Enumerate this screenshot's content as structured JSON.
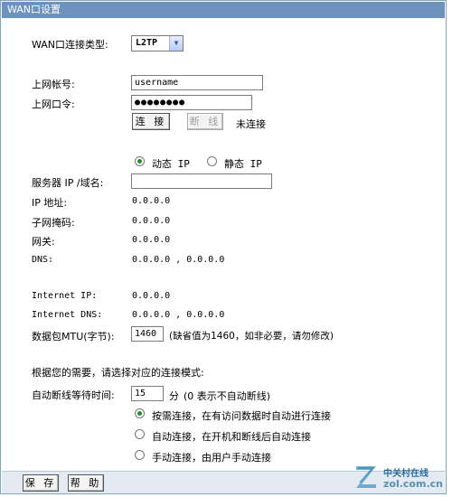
{
  "title": "WAN口设置",
  "wan_type": {
    "label": "WAN口连接类型:",
    "value": "L2TP"
  },
  "account": {
    "label": "上网帐号:",
    "value": "username"
  },
  "password": {
    "label": "上网口令:",
    "value": "●●●●●●●●"
  },
  "connect_button": "连 接",
  "disconnect_button": "断 线",
  "connection_status": "未连接",
  "ip_mode": {
    "dynamic": "动态 IP",
    "static": "静态 IP",
    "selected": "dynamic"
  },
  "server": {
    "label": "服务器 IP /域名:",
    "value": ""
  },
  "ip_address": {
    "label": "IP 地址:",
    "value": "0.0.0.0"
  },
  "subnet_mask": {
    "label": "子网掩码:",
    "value": "0.0.0.0"
  },
  "gateway": {
    "label": "网关:",
    "value": "0.0.0.0"
  },
  "dns": {
    "label": "DNS:",
    "value": "0.0.0.0 , 0.0.0.0"
  },
  "internet_ip": {
    "label": "Internet IP:",
    "value": "0.0.0.0"
  },
  "internet_dns": {
    "label": "Internet DNS:",
    "value": "0.0.0.0 , 0.0.0.0"
  },
  "mtu": {
    "label": "数据包MTU(字节):",
    "value": "1460",
    "hint": "(缺省值为1460，如非必要，请勿修改)"
  },
  "mode_prompt": "根据您的需要，请选择对应的连接模式:",
  "idle_wait": {
    "label": "自动断线等待时间:",
    "value": "15",
    "unit": "分",
    "hint": "(0 表示不自动断线)"
  },
  "modes": [
    {
      "label": "按需连接，在有访问数据时自动进行连接",
      "checked": true
    },
    {
      "label": "自动连接，在开机和断线后自动连接",
      "checked": false
    },
    {
      "label": "手动连接，由用户手动连接",
      "checked": false
    }
  ],
  "save_button": "保 存",
  "help_button": "帮 助",
  "watermark": {
    "brand": "中关村在线",
    "site": "zol.com.cn"
  },
  "colors": {
    "title_bar": "#6d93bd",
    "footer_bar": "#e4eaf2",
    "radio_dot": "#2a8a2a"
  }
}
